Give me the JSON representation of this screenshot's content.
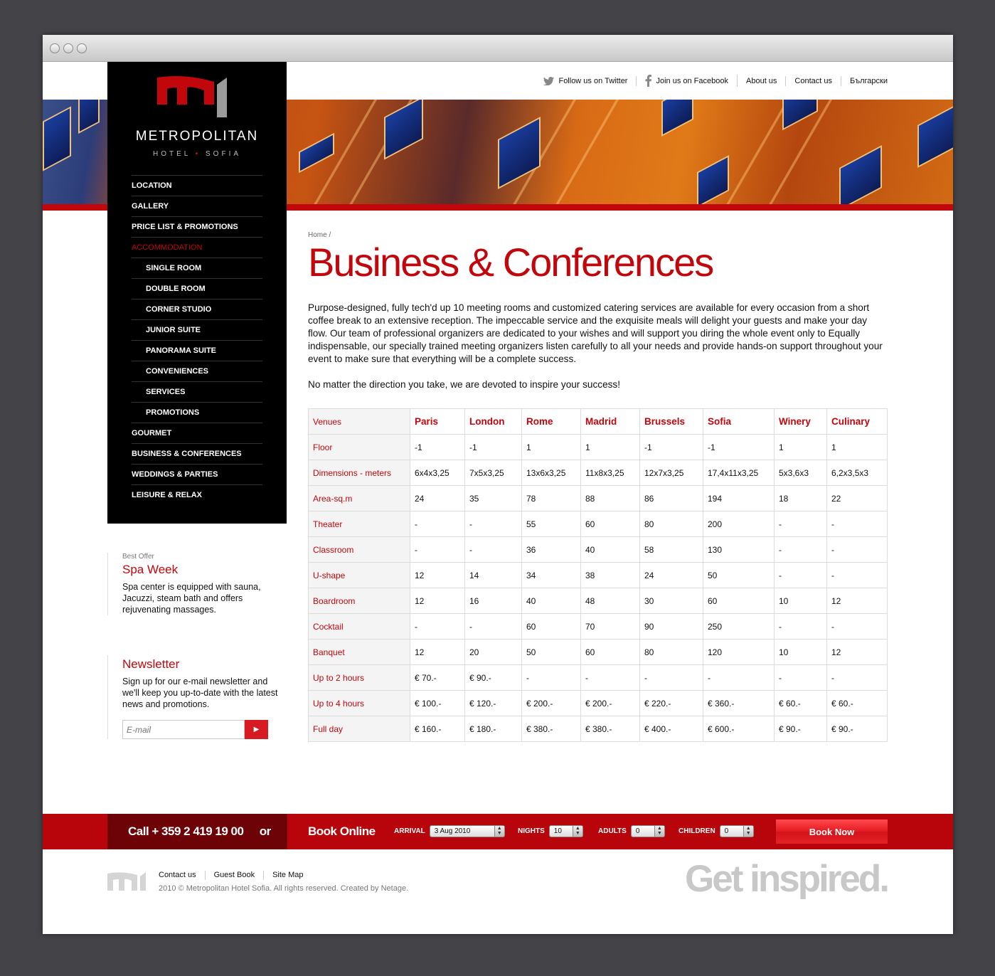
{
  "toplinks": {
    "twitter": "Follow us on Twitter",
    "facebook": "Join us on Facebook",
    "about": "About us",
    "contact": "Contact us",
    "language": "Български"
  },
  "brand": {
    "name": "METROPOLITAN",
    "sub_left": "HOTEL",
    "sub_dot": "•",
    "sub_right": "SOFIA"
  },
  "nav": [
    "LOCATION",
    "GALLERY",
    "PRICE LIST & PROMOTIONS",
    "ACCOMMODATION",
    "SINGLE ROOM",
    "DOUBLE ROOM",
    "CORNER STUDIO",
    "JUNIOR SUITE",
    "PANORAMA SUITE",
    "CONVENIENCES",
    "SERVICES",
    "PROMOTIONS",
    "GOURMET",
    "BUSINESS & CONFERENCES",
    "WEDDINGS & PARTIES",
    "LEISURE & RELAX"
  ],
  "offer": {
    "small": "Best Offer",
    "title": "Spa Week",
    "text": "Spa center is equipped with sauna, Jacuzzi, steam bath and offers rejuvenating massages."
  },
  "newsletter": {
    "title": "Newsletter",
    "text": "Sign up for our e-mail newsletter and we'll keep you up-to-date with the latest news and promotions.",
    "placeholder": "E-mail"
  },
  "content": {
    "breadcrumb": "Home /",
    "title": "Business & Conferences",
    "para1": "Purpose-designed, fully tech'd up 10 meeting rooms and customized catering services are available for every occasion from a short coffee break to an extensive reception. The impeccable service and the exquisite meals will delight your guests and make your day flow. Our team of professional organizers are dedicated to your wishes and will support you diring the whole event only to Equally indispensable, our specially trained meeting organizers listen carefully to all your needs and provide hands-on support throughout your event to make sure that everything will be a complete success.",
    "para2": "No matter the direction you take, we are devoted to inspire your success!"
  },
  "table": {
    "corner": "Venues",
    "columns": [
      "Paris",
      "London",
      "Rome",
      "Madrid",
      "Brussels",
      "Sofia",
      "Winery",
      "Culinary"
    ],
    "rows": [
      {
        "label": "Floor",
        "cells": [
          "-1",
          "-1",
          "1",
          "1",
          "-1",
          "-1",
          "1",
          "1"
        ]
      },
      {
        "label": "Dimensions - meters",
        "cells": [
          "6x4x3,25",
          "7x5x3,25",
          "13x6x3,25",
          "11x8x3,25",
          "12x7x3,25",
          "17,4x11x3,25",
          "5x3,6x3",
          "6,2x3,5x3"
        ]
      },
      {
        "label": "Area-sq.m",
        "cells": [
          "24",
          "35",
          "78",
          "88",
          "86",
          "194",
          "18",
          "22"
        ]
      },
      {
        "label": "Theater",
        "cells": [
          " -",
          "-",
          "55",
          "60",
          "80",
          "200",
          "-",
          "-"
        ]
      },
      {
        "label": "Classroom",
        "cells": [
          " -",
          "-",
          "36",
          "40",
          "58",
          "130",
          "-",
          "-"
        ]
      },
      {
        "label": "U-shape",
        "cells": [
          "12",
          "14",
          "34",
          "38",
          "24",
          "50",
          "-",
          "-"
        ]
      },
      {
        "label": "Boardroom",
        "cells": [
          "12",
          "16",
          "40",
          "48",
          "30",
          "60",
          "10",
          "12"
        ]
      },
      {
        "label": "Cocktail",
        "cells": [
          "-",
          "-",
          "60",
          "70",
          "90",
          "250",
          "-",
          "-"
        ]
      },
      {
        "label": "Banquet",
        "cells": [
          "12",
          "20",
          "50",
          "60",
          "80",
          "120",
          "10",
          "12"
        ]
      },
      {
        "label": "Up to 2 hours",
        "cells": [
          "€ 70.-",
          "€ 90.-",
          "-",
          "-",
          "-",
          "-",
          "-",
          "-"
        ]
      },
      {
        "label": "Up to 4 hours",
        "cells": [
          "€ 100.-",
          "€ 120.-",
          "€ 200.-",
          "€ 200.-",
          "€ 220.-",
          "€ 360.-",
          "€ 60.-",
          "€ 60.-"
        ]
      },
      {
        "label": "Full day",
        "cells": [
          "€ 160.-",
          "€ 180.-",
          "€ 380.-",
          "€ 380.-",
          "€ 400.-",
          "€ 600.-",
          "€ 90.-",
          "€ 90.-"
        ]
      }
    ]
  },
  "booking": {
    "call": "Call  + 359 2 419 19 00",
    "or": "or",
    "book_online": "Book Online",
    "arrival_label": "ARRIVAL",
    "arrival_value": "3 Aug 2010",
    "nights_label": "NIGHTS",
    "nights_value": "10",
    "adults_label": "ADULTS",
    "adults_value": "0",
    "children_label": "CHILDREN",
    "children_value": "0",
    "book_now": "Book Now"
  },
  "footer": {
    "contact": "Contact us",
    "guestbook": "Guest Book",
    "sitemap": "Site Map",
    "copyright": "2010 © Metropolitan Hotel Sofia. All rights reserved. Created by Netage.",
    "slogan": "Get inspired."
  },
  "colors": {
    "accent": "#c1060c",
    "sidebar": "#000000",
    "bookbar": "#b8050b"
  }
}
